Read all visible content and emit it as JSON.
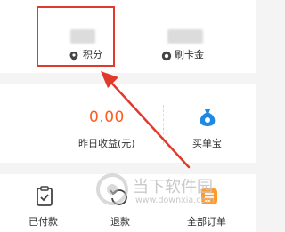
{
  "top": {
    "points_label": "积分",
    "card_reward_label": "刷卡金"
  },
  "earnings": {
    "value": "0.00",
    "label": "昨日收益(元)"
  },
  "maidanbao": {
    "label": "买单宝"
  },
  "orders": {
    "paid_label": "已付款",
    "refund_label": "退款",
    "all_label": "全部订单"
  },
  "watermark": {
    "title": "当下软件园",
    "url": "www.downxia.com"
  },
  "colors": {
    "highlight": "#e03a2c",
    "earnings_value": "#ff5a1f",
    "brand_blue": "#1e88e5",
    "all_orders_badge": "#ff9a2b"
  },
  "icons": [
    "location-pin-icon",
    "coin-icon",
    "money-bag-icon",
    "clipboard-check-icon",
    "refund-icon",
    "orders-icon"
  ]
}
